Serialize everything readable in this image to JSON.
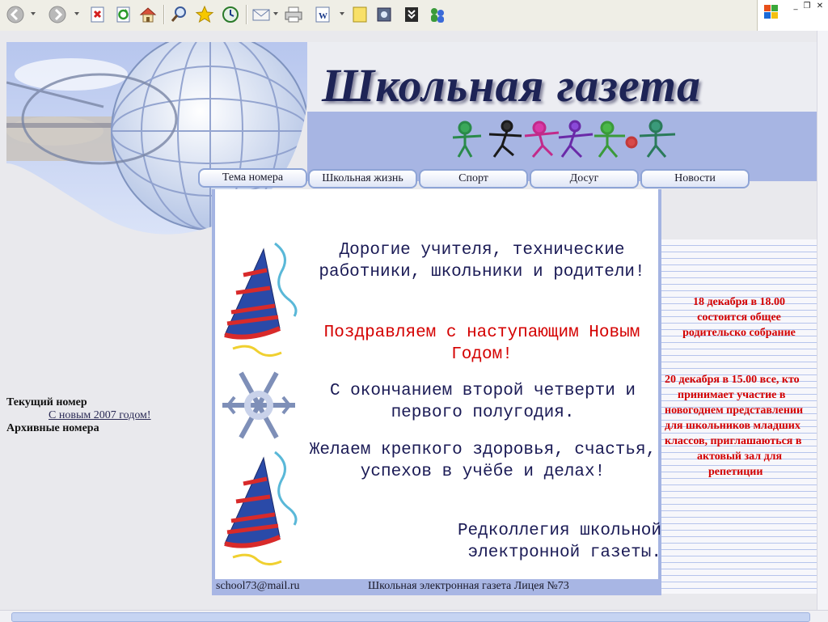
{
  "browser": {
    "toolbar_icons": [
      "back-icon",
      "forward-icon",
      "stop-icon",
      "refresh-icon",
      "home-icon",
      "search-icon",
      "favorites-icon",
      "history-icon",
      "mail-icon",
      "print-icon",
      "edit-icon",
      "discuss-icon",
      "research-icon",
      "messenger-icon",
      "messenger2-icon"
    ],
    "window_controls": [
      "minimize",
      "restore",
      "close"
    ]
  },
  "header": {
    "title": "Школьная  газета"
  },
  "nav": [
    {
      "label": "Тема номера"
    },
    {
      "label": "Школьная жизнь"
    },
    {
      "label": "Спорт"
    },
    {
      "label": "Досуг"
    },
    {
      "label": "Новости"
    }
  ],
  "main": {
    "greeting": "Дорогие учителя, технические работники, школьники и родители!",
    "congrats": "Поздравляем с наступающим Новым Годом!",
    "quarter": "С окончанием второй четверти и первого полугодия.",
    "wishes": "Желаем крепкого здоровья, счастья, успехов в учёбе и делах!",
    "signature": "Редколлегия школьной электронной газеты."
  },
  "footer": {
    "email": "school73@mail.ru",
    "credit": "Школьная электронная газета Лицея №73"
  },
  "sidebar": {
    "current_issue_label": "Текущий номер",
    "current_issue_link": "С новым 2007 годом!",
    "archive_label": "Архивные номера"
  },
  "announcements": [
    {
      "lines": [
        "18 декабря в 18.00",
        "состоится общее",
        "родительско собрание"
      ]
    },
    {
      "lines": [
        "20 декабря в 15.00 все, кто",
        "принимает участие в",
        "новогоднем представлении",
        "для школьников младших",
        "классов, приглашаються в",
        "актовый зал для",
        "репетиции"
      ]
    }
  ],
  "colors": {
    "title": "#1e2456",
    "accent_red": "#d40000",
    "band_blue": "#a7b5e3",
    "text_navy": "#1a1a55"
  }
}
